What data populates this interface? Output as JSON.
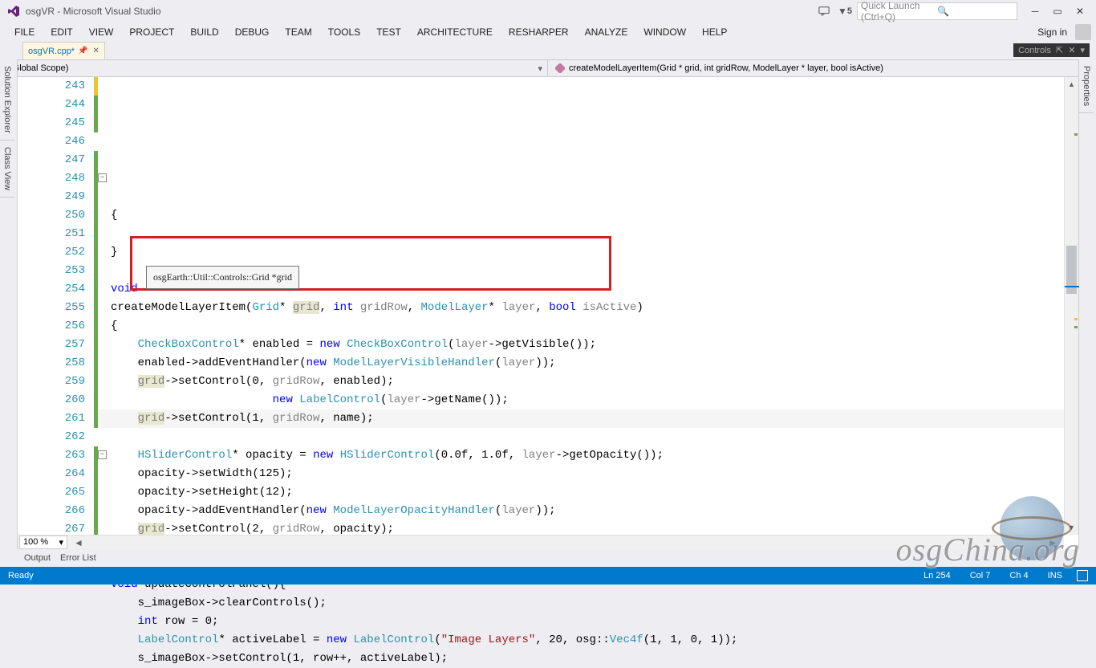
{
  "title": "osgVR - Microsoft Visual Studio",
  "flag_count": "5",
  "quick_launch_placeholder": "Quick Launch (Ctrl+Q)",
  "menu": [
    "FILE",
    "EDIT",
    "VIEW",
    "PROJECT",
    "BUILD",
    "DEBUG",
    "TEAM",
    "TOOLS",
    "TEST",
    "ARCHITECTURE",
    "RESHARPER",
    "ANALYZE",
    "WINDOW",
    "HELP"
  ],
  "sign_in": "Sign in",
  "tab_name": "osgVR.cpp*",
  "controls_label": "Controls",
  "scope_left": "(Global Scope)",
  "scope_right": "createModelLayerItem(Grid * grid, int gridRow, ModelLayer * layer, bool isActive)",
  "side_tabs_left": [
    "Solution Explorer",
    "Class View"
  ],
  "side_tabs_right": [
    "Properties"
  ],
  "tooltip": "osgEarth::Util::Controls::Grid *grid",
  "zoom": "100 %",
  "bottom_tabs": [
    "Output",
    "Error List"
  ],
  "status_ready": "Ready",
  "status_line": "Ln 254",
  "status_col": "Col 7",
  "status_ch": "Ch 4",
  "status_ins": "INS",
  "watermark": "osgChina.org",
  "lines": [
    {
      "n": 243,
      "html": "{"
    },
    {
      "n": 244,
      "html": ""
    },
    {
      "n": 245,
      "html": "}"
    },
    {
      "n": 246,
      "html": ""
    },
    {
      "n": 247,
      "html": "<span class='kw'>void</span>"
    },
    {
      "n": 248,
      "html": "createModelLayerItem(<span class='typ'>Grid</span>* <span class='param hl'>grid</span>, <span class='kw'>int</span> <span class='param'>gridRow</span>, <span class='typ'>ModelLayer</span>* <span class='param'>layer</span>, <span class='kw'>bool</span> <span class='param'>isActive</span>)"
    },
    {
      "n": 249,
      "html": "{"
    },
    {
      "n": 250,
      "html": "    <span class='typ'>CheckBoxControl</span>* enabled = <span class='kw'>new</span> <span class='typ'>CheckBoxControl</span>(<span class='param'>layer</span>-&gt;getVisible());"
    },
    {
      "n": 251,
      "html": "    enabled-&gt;addEventHandler(<span class='kw'>new</span> <span class='typ'>ModelLayerVisibleHandler</span>(<span class='param'>layer</span>));"
    },
    {
      "n": 252,
      "html": "    <span class='param hl'>grid</span>-&gt;setControl(0, <span class='param'>gridRow</span>, enabled);"
    },
    {
      "n": 253,
      "html": "                        <span class='kw'>new</span> <span class='typ'>LabelControl</span>(<span class='param'>layer</span>-&gt;getName());"
    },
    {
      "n": 254,
      "html": "    <span class='param hl'>grid</span>-&gt;setControl(1, <span class='param'>gridRow</span>, name);",
      "cur": true
    },
    {
      "n": 255,
      "html": ""
    },
    {
      "n": 256,
      "html": "    <span class='typ'>HSliderControl</span>* opacity = <span class='kw'>new</span> <span class='typ'>HSliderControl</span>(0.0f, 1.0f, <span class='param'>layer</span>-&gt;getOpacity());"
    },
    {
      "n": 257,
      "html": "    opacity-&gt;setWidth(125);"
    },
    {
      "n": 258,
      "html": "    opacity-&gt;setHeight(12);"
    },
    {
      "n": 259,
      "html": "    opacity-&gt;addEventHandler(<span class='kw'>new</span> <span class='typ'>ModelLayerOpacityHandler</span>(<span class='param'>layer</span>));"
    },
    {
      "n": 260,
      "html": "    <span class='param hl'>grid</span>-&gt;setControl(2, <span class='param'>gridRow</span>, opacity);"
    },
    {
      "n": 261,
      "html": "}"
    },
    {
      "n": 262,
      "html": ""
    },
    {
      "n": 263,
      "html": "<span class='kw'>void</span> updateControlPanel(){"
    },
    {
      "n": 264,
      "html": "    s_imageBox-&gt;clearControls();"
    },
    {
      "n": 265,
      "html": "    <span class='kw'>int</span> row = 0;"
    },
    {
      "n": 266,
      "html": "    <span class='typ'>LabelControl</span>* activeLabel = <span class='kw'>new</span> <span class='typ'>LabelControl</span>(<span class='str'>\"Image Layers\"</span>, 20, osg::<span class='typ'>Vec4f</span>(1, 1, 0, 1));"
    },
    {
      "n": 267,
      "html": "    s_imageBox-&gt;setControl(1, row++, activeLabel);"
    }
  ]
}
